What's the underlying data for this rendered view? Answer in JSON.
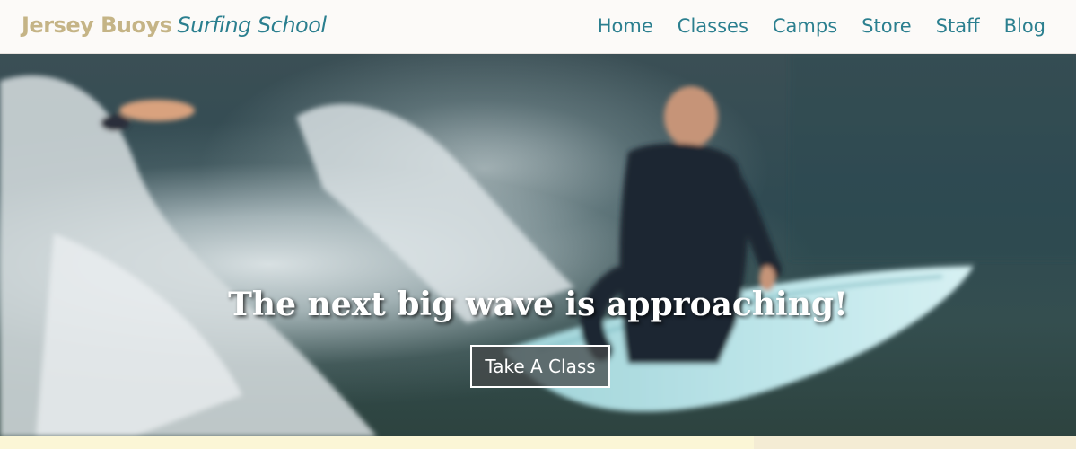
{
  "brand": {
    "part1": "Jersey Buoys",
    "part2": "Surfing School"
  },
  "nav": [
    {
      "label": "Home"
    },
    {
      "label": "Classes"
    },
    {
      "label": "Camps"
    },
    {
      "label": "Store"
    },
    {
      "label": "Staff"
    },
    {
      "label": "Blog"
    }
  ],
  "hero": {
    "title": "The next big wave is approaching!",
    "cta_label": "Take A Class"
  },
  "colors": {
    "brand_gold": "#c5b486",
    "accent_teal": "#2b7f8f",
    "footer_strip": "#fbf6d6"
  }
}
